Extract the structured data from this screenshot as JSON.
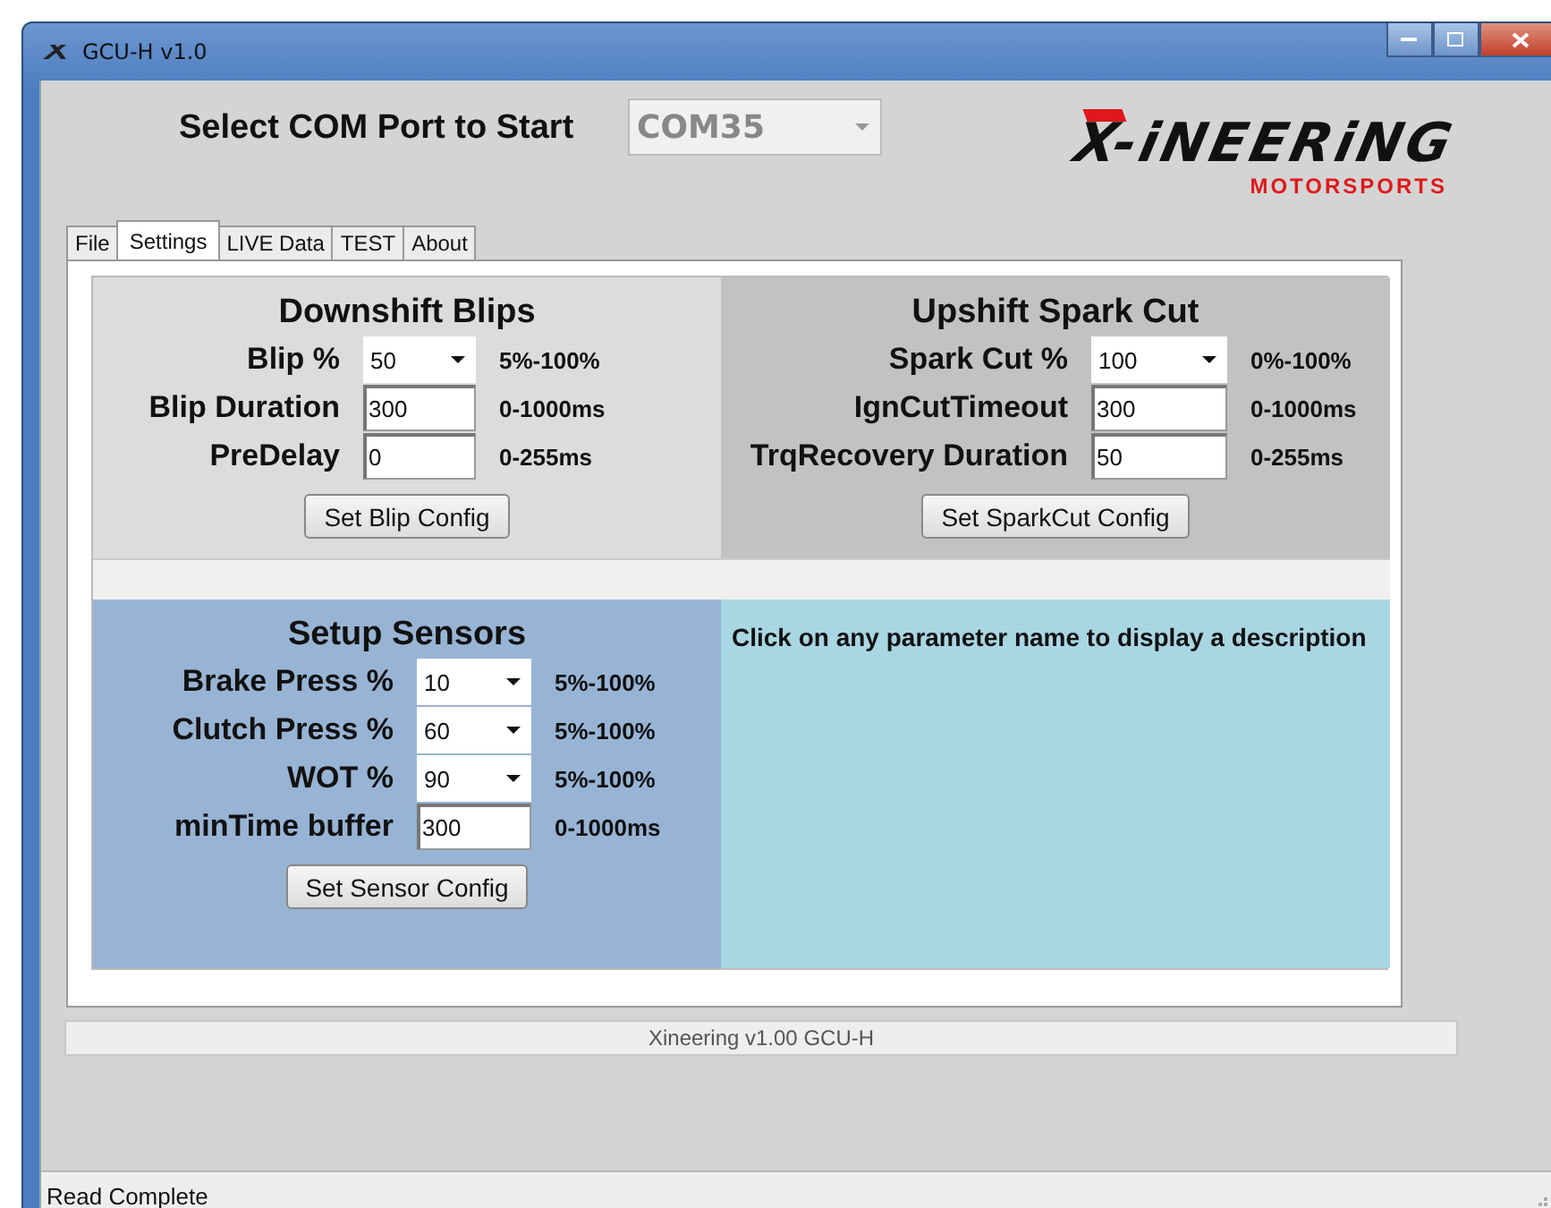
{
  "window": {
    "title": "GCU-H v1.0"
  },
  "com_port": {
    "label": "Select COM Port to Start",
    "value": "COM35",
    "disabled": true
  },
  "logo": {
    "wordmark": "X-iNEERiNG",
    "tagline": "MOTORSPORTS"
  },
  "tabs": [
    {
      "label": "File",
      "selected": false
    },
    {
      "label": "Settings",
      "selected": true
    },
    {
      "label": "LIVE Data",
      "selected": false
    },
    {
      "label": "TEST",
      "selected": false
    },
    {
      "label": "About",
      "selected": false
    }
  ],
  "downshift": {
    "title": "Downshift Blips",
    "rows": [
      {
        "label": "Blip %",
        "kind": "dropdown",
        "value": "50",
        "range": "5%-100%"
      },
      {
        "label": "Blip Duration",
        "kind": "text",
        "value": "300",
        "range": "0-1000ms"
      },
      {
        "label": "PreDelay",
        "kind": "text",
        "value": "0",
        "range": "0-255ms"
      }
    ],
    "button": "Set Blip Config"
  },
  "upshift": {
    "title": "Upshift Spark Cut",
    "rows": [
      {
        "label": "Spark Cut %",
        "kind": "dropdown",
        "value": "100",
        "range": "0%-100%"
      },
      {
        "label": "IgnCutTimeout",
        "kind": "text",
        "value": "300",
        "range": "0-1000ms"
      },
      {
        "label": "TrqRecovery Duration",
        "kind": "text",
        "value": "50",
        "range": "0-255ms"
      }
    ],
    "button": "Set SparkCut Config"
  },
  "sensors": {
    "title": "Setup Sensors",
    "rows": [
      {
        "label": "Brake Press %",
        "kind": "dropdown",
        "value": "10",
        "range": "5%-100%"
      },
      {
        "label": "Clutch Press %",
        "kind": "dropdown",
        "value": "60",
        "range": "5%-100%"
      },
      {
        "label": "WOT %",
        "kind": "dropdown",
        "value": "90",
        "range": "5%-100%"
      },
      {
        "label": "minTime  buffer",
        "kind": "text",
        "value": "300",
        "range": "0-1000ms"
      }
    ],
    "button": "Set Sensor Config"
  },
  "description": {
    "text": "Click on any parameter name to display a description"
  },
  "version_bar": {
    "text": "Xineering v1.00 GCU-H"
  },
  "status_bar": {
    "text": "Read Complete"
  }
}
